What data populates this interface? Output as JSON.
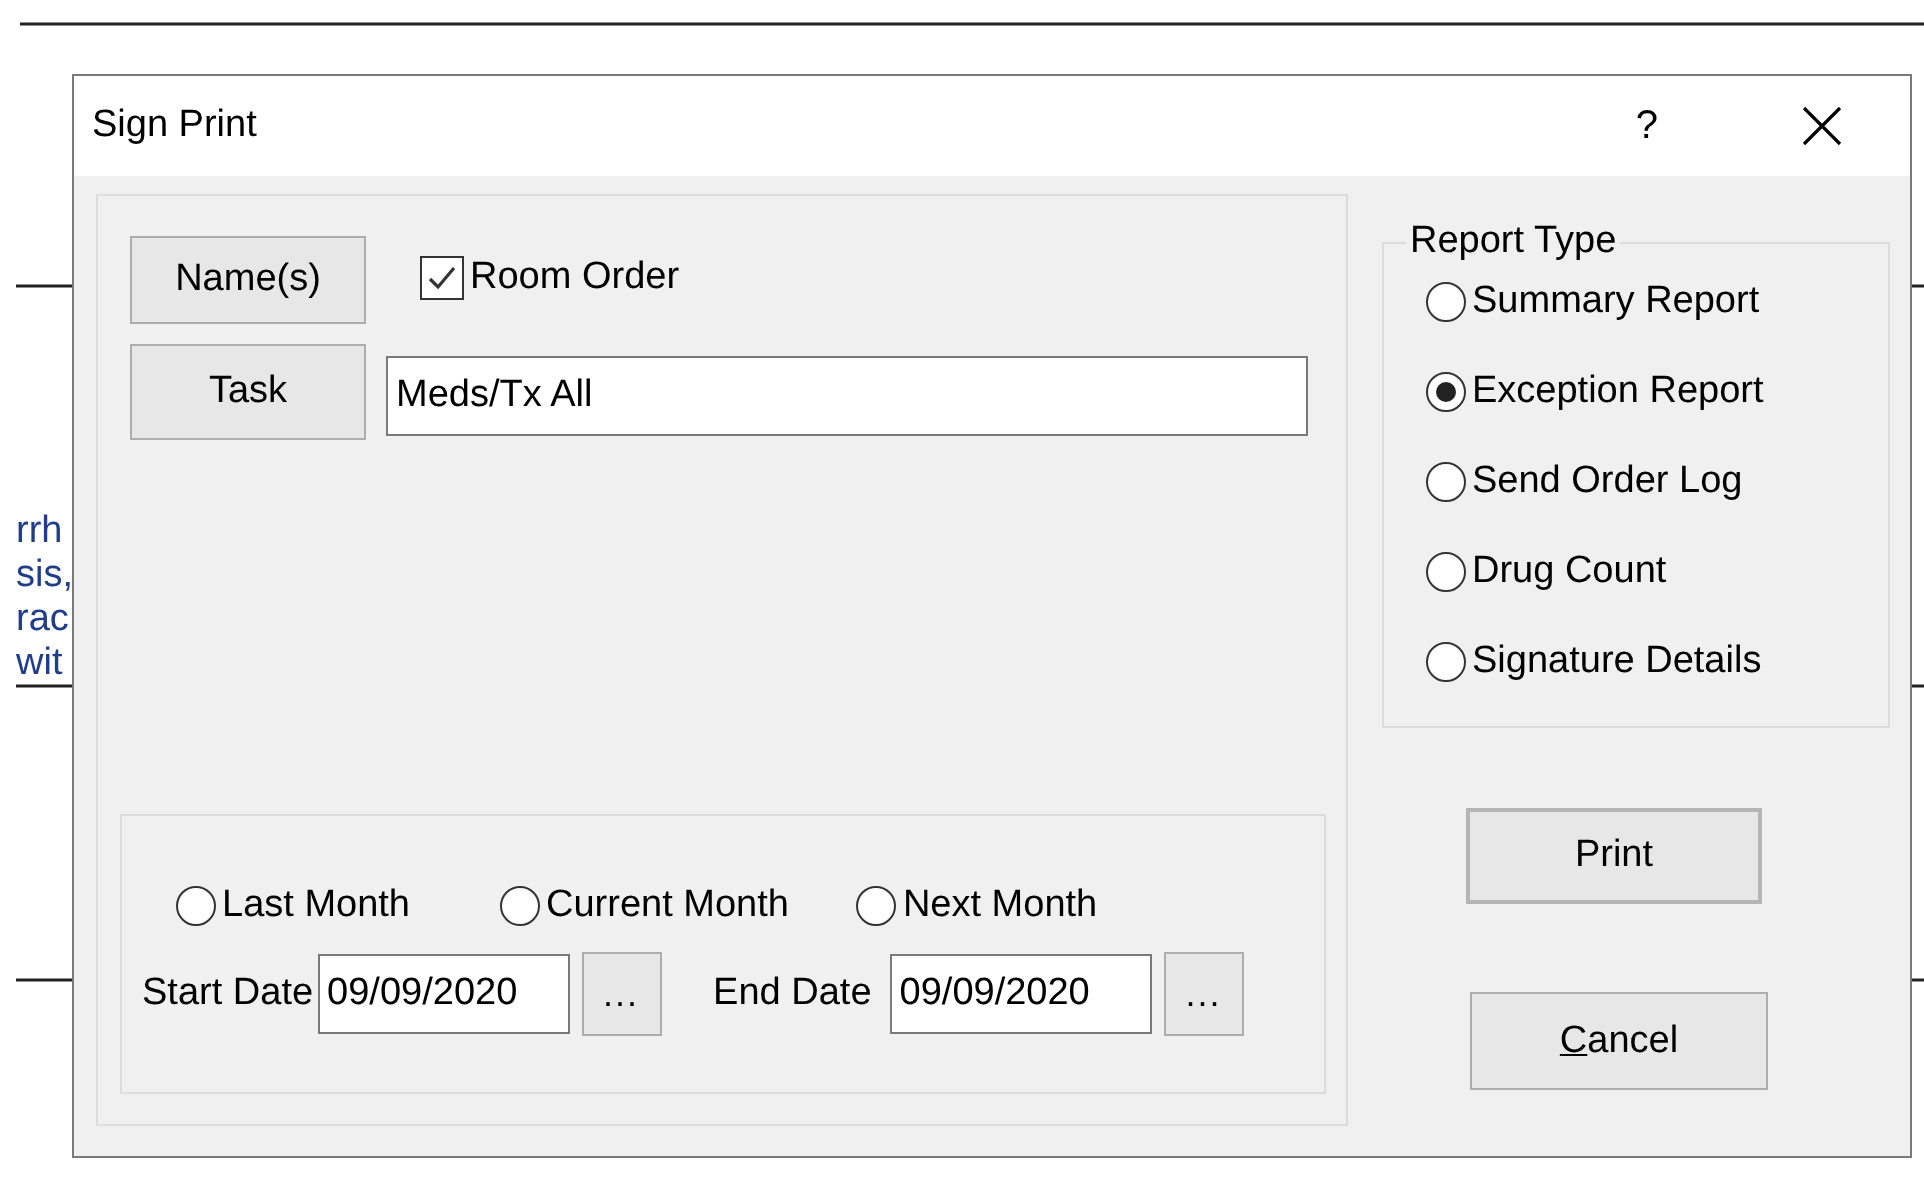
{
  "background_text": [
    "rrh",
    "sis,",
    "rac",
    "wit"
  ],
  "window": {
    "title": "Sign Print",
    "help": "?"
  },
  "names_button": "Name(s)",
  "room_order": {
    "label": "Room Order",
    "checked": true
  },
  "task_button": "Task",
  "task_field": {
    "value": "Meds/Tx All"
  },
  "period": [
    {
      "label": "Last Month",
      "selected": false
    },
    {
      "label": "Current Month",
      "selected": false
    },
    {
      "label": "Next Month",
      "selected": false
    }
  ],
  "start_date": {
    "label": "Start Date",
    "value": "09/09/2020",
    "browse": "..."
  },
  "end_date": {
    "label": "End Date",
    "value": "09/09/2020",
    "browse": "..."
  },
  "report_type": {
    "title": "Report Type",
    "options": [
      {
        "label": "Summary Report",
        "selected": false
      },
      {
        "label": "Exception Report",
        "selected": true
      },
      {
        "label": "Send Order Log",
        "selected": false
      },
      {
        "label": "Drug Count",
        "selected": false
      },
      {
        "label": "Signature Details",
        "selected": false
      }
    ]
  },
  "print_button": {
    "label": "Print"
  },
  "cancel_button": {
    "label": "Cancel",
    "first_letter_underlined": true
  }
}
